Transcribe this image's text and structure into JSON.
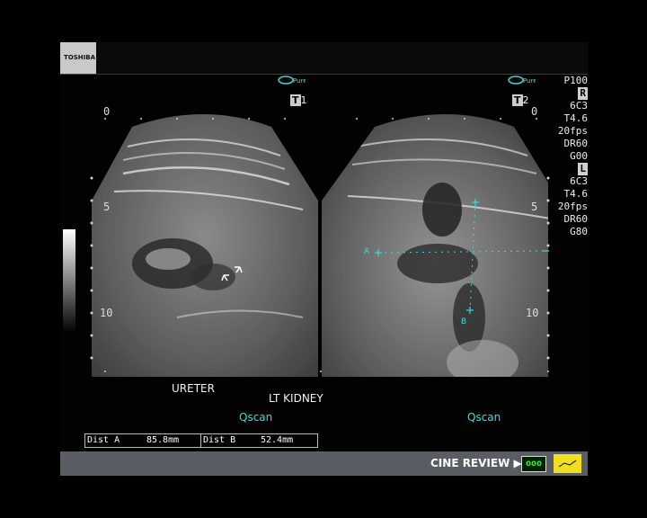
{
  "brand": "TOSHIBA",
  "params": {
    "p": "P100",
    "r_label": "R",
    "r_probe": "6C3",
    "r_t": "T4.6",
    "r_fps": "20fps",
    "r_dr": "DR60",
    "r_g": "G00",
    "l_label": "L",
    "l_probe": "6C3",
    "l_t": "T4.6",
    "l_fps": "20fps",
    "l_dr": "DR60",
    "l_g": "G80"
  },
  "panels": {
    "left_tag": "1",
    "right_tag": "2",
    "left_depth": [
      "0",
      "5",
      "10"
    ],
    "right_depth": [
      "0",
      "5",
      "10"
    ]
  },
  "annotations": {
    "ureter": "URETER",
    "lt_kidney": "LT KIDNEY",
    "qscan_left": "Qscan",
    "qscan_right": "Qscan",
    "caliper_a": "A",
    "caliper_b": "B"
  },
  "measurements": {
    "dist_a_label": "Dist A",
    "dist_a_value": "85.8mm",
    "dist_b_label": "Dist B",
    "dist_b_value": "52.4mm"
  },
  "footer": {
    "cine_review": "CINE REVIEW ▶",
    "cine_button": "ooo",
    "pure_label": "Pure"
  },
  "colors": {
    "accent_cyan": "#30e0e0",
    "footer_bar": "#5a5d63",
    "cine_button_bg": "#f0e020"
  }
}
